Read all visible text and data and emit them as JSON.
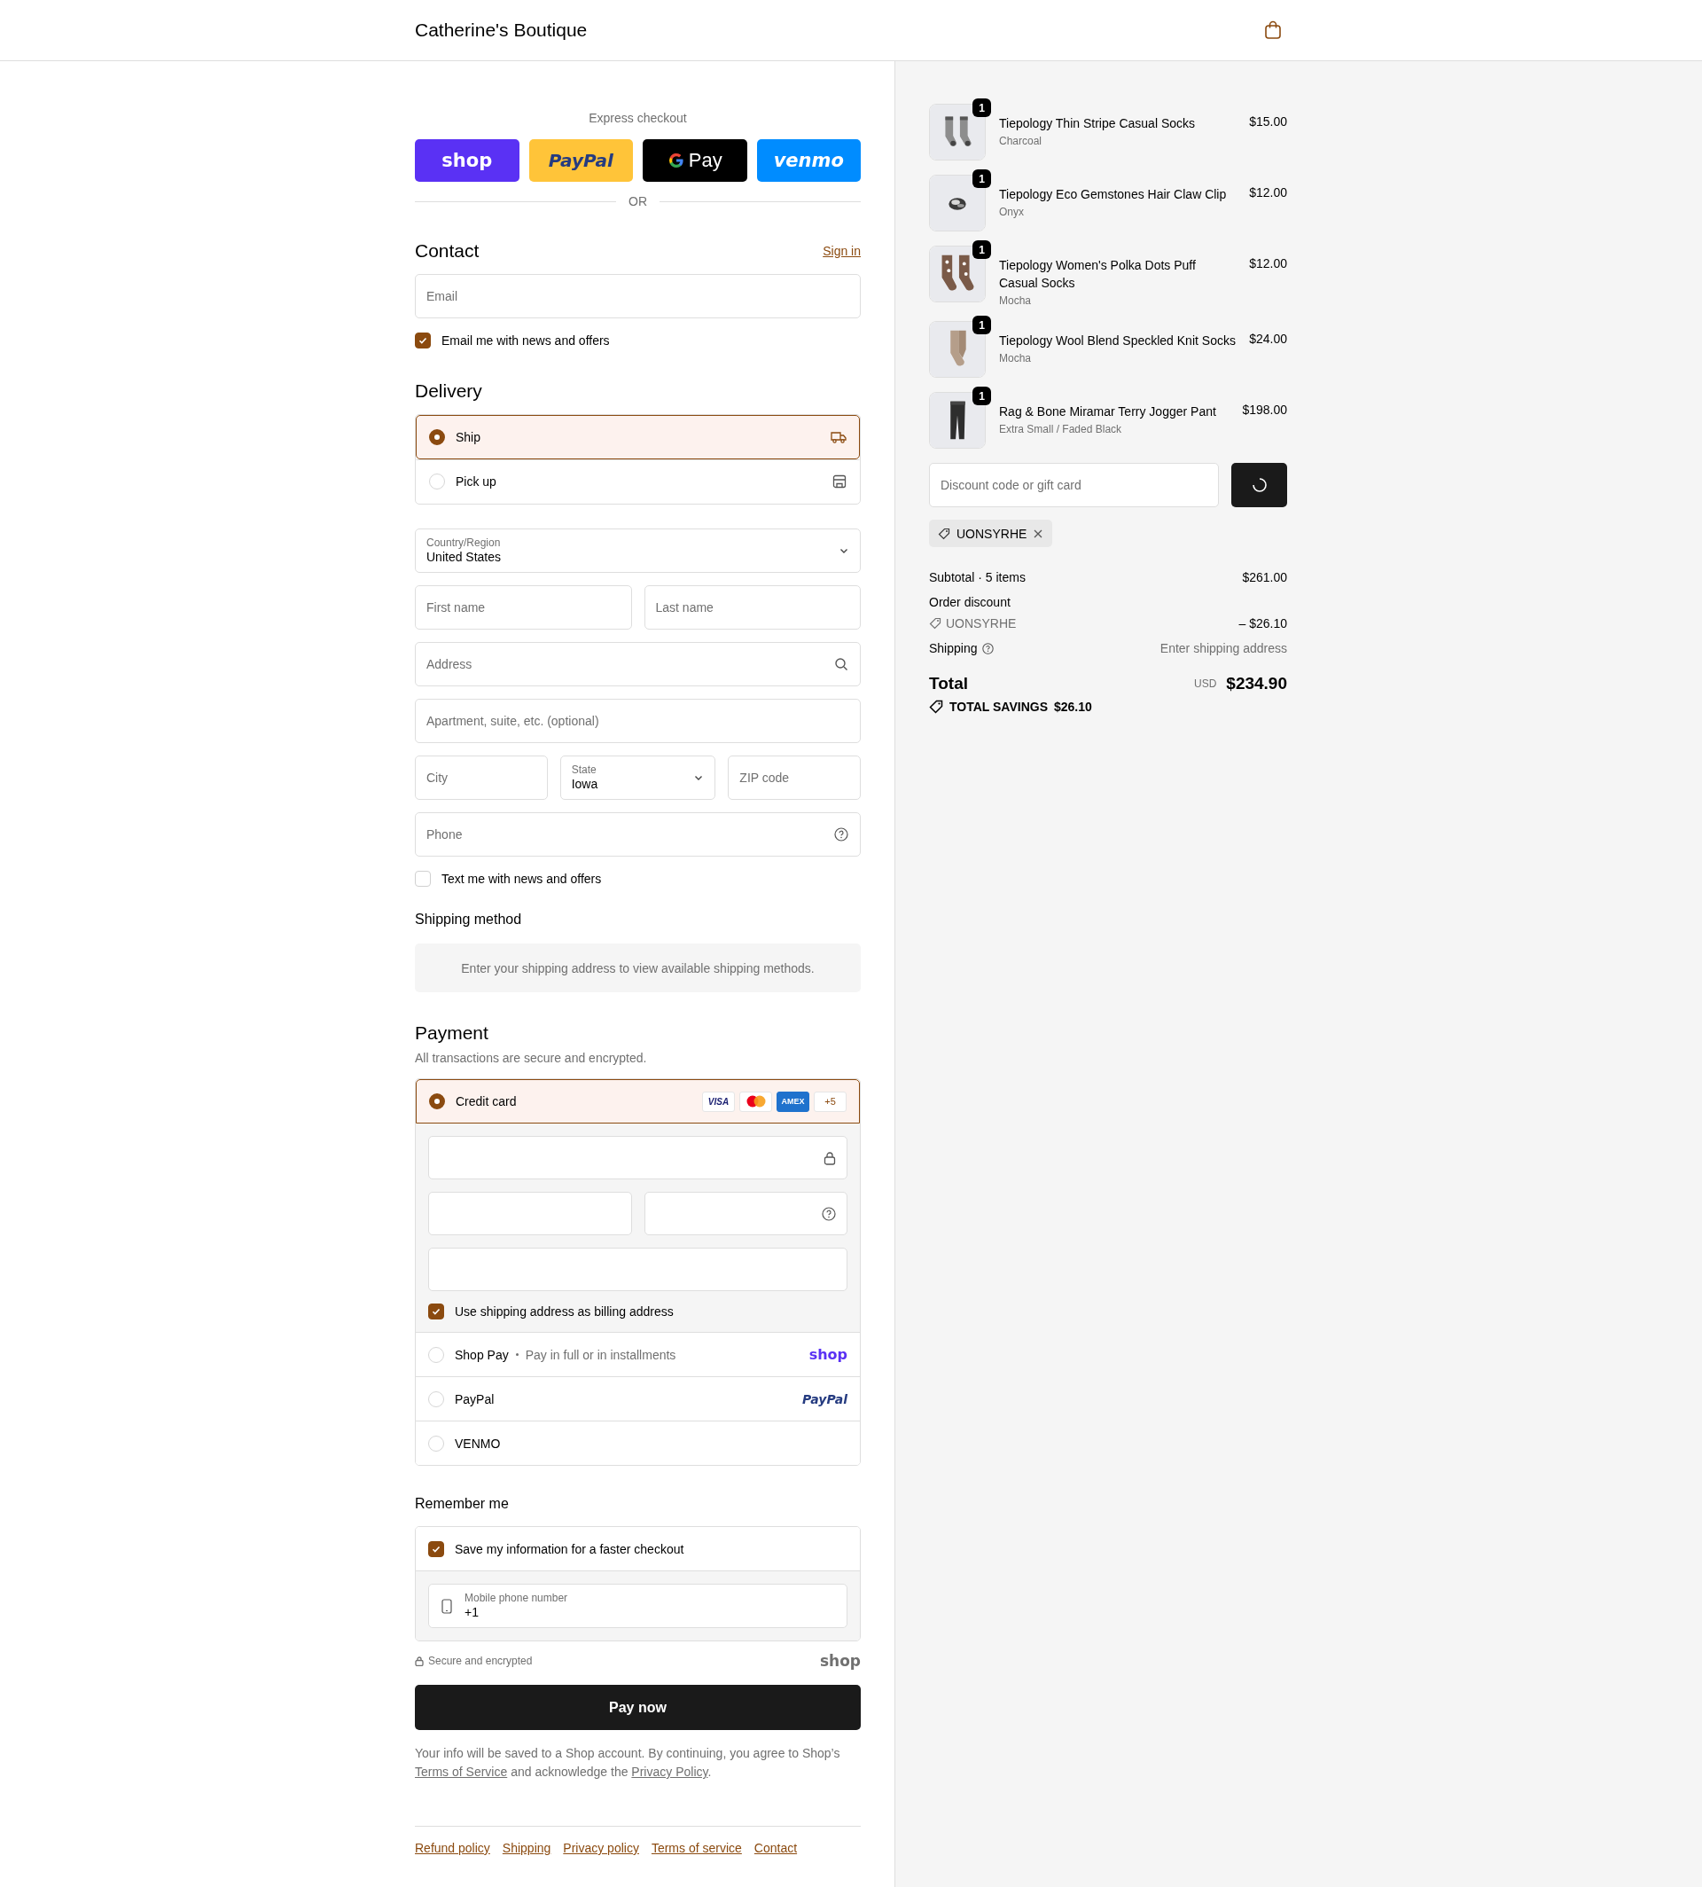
{
  "header": {
    "store_name": "Catherine's Boutique"
  },
  "express_checkout": {
    "title": "Express checkout",
    "divider": "OR",
    "buttons": [
      {
        "kind": "shop",
        "label": "shop"
      },
      {
        "kind": "paypal",
        "label": "PayPal"
      },
      {
        "kind": "gpay",
        "label": "Pay"
      },
      {
        "kind": "venmo",
        "label": "venmo"
      }
    ]
  },
  "contact": {
    "title": "Contact",
    "sign_in": "Sign in",
    "email": {
      "placeholder": "Email"
    },
    "newsletter": {
      "label": "Email me with news and offers",
      "checked": true
    }
  },
  "delivery": {
    "title": "Delivery",
    "options": [
      {
        "kind": "ship",
        "label": "Ship",
        "selected": true
      },
      {
        "kind": "pickup",
        "label": "Pick up",
        "selected": false
      }
    ],
    "address_rows": [
      [
        {
          "kind": "select",
          "label": "Country/Region",
          "value": "United States"
        }
      ],
      [
        {
          "kind": "text",
          "placeholder": "First name"
        },
        {
          "kind": "text",
          "placeholder": "Last name"
        }
      ],
      [
        {
          "kind": "search",
          "placeholder": "Address"
        }
      ],
      [
        {
          "kind": "text",
          "placeholder": "Apartment, suite, etc. (optional)"
        }
      ],
      [
        {
          "kind": "text",
          "placeholder": "City"
        },
        {
          "kind": "select",
          "label": "State",
          "value": "Iowa"
        },
        {
          "kind": "text",
          "placeholder": "ZIP code"
        }
      ],
      [
        {
          "kind": "phone",
          "placeholder": "Phone"
        }
      ]
    ],
    "sms": {
      "label": "Text me with news and offers",
      "checked": false
    }
  },
  "shipping_method": {
    "title": "Shipping method",
    "notice": "Enter your shipping address to view available shipping methods."
  },
  "payment": {
    "title": "Payment",
    "subtitle": "All transactions are secure and encrypted.",
    "methods": [
      {
        "kind": "card",
        "label": "Credit card",
        "selected": true,
        "brands": [
          {
            "kind": "visa",
            "label": "VISA"
          },
          {
            "kind": "mastercard"
          },
          {
            "kind": "amex",
            "label": "AMEX"
          },
          {
            "kind": "more",
            "label": "+5"
          }
        ],
        "billing": {
          "label": "Use shipping address as billing address",
          "checked": true
        }
      },
      {
        "kind": "shoppay",
        "label": "Shop Pay",
        "note": "Pay in full or in installments",
        "logo": "shop",
        "selected": false
      },
      {
        "kind": "paypal",
        "label": "PayPal",
        "logo": "PayPal",
        "selected": false
      },
      {
        "kind": "venmo",
        "label": "VENMO",
        "selected": false
      }
    ]
  },
  "remember_me": {
    "title": "Remember me",
    "save": {
      "label": "Save my information for a faster checkout",
      "checked": true
    },
    "phone": {
      "label": "Mobile phone number",
      "value": "+1"
    }
  },
  "secure_note": "Secure and encrypted",
  "shop_logo": "shop",
  "pay_button": "Pay now",
  "legal": [
    {
      "kind": "text",
      "text": "Your info will be saved to a Shop account. By continuing, you agree to Shop’s "
    },
    {
      "kind": "link",
      "text": "Terms of Service"
    },
    {
      "kind": "text",
      "text": " and acknowledge the "
    },
    {
      "kind": "link",
      "text": "Privacy Policy"
    },
    {
      "kind": "text",
      "text": "."
    }
  ],
  "footer_links": [
    "Refund policy",
    "Shipping",
    "Privacy policy",
    "Terms of service",
    "Contact"
  ],
  "order_summary": {
    "items": [
      {
        "name": "Tiepology Thin Stripe Casual Socks",
        "variant": "Charcoal",
        "price": "$15.00",
        "quantity": "1"
      },
      {
        "name": "Tiepology Eco Gemstones Hair Claw Clip",
        "variant": "Onyx",
        "price": "$12.00",
        "quantity": "1"
      },
      {
        "name": "Tiepology Women's Polka Dots Puff Casual Socks",
        "variant": "Mocha",
        "price": "$12.00",
        "quantity": "1"
      },
      {
        "name": "Tiepology Wool Blend Speckled Knit Socks",
        "variant": "Mocha",
        "price": "$24.00",
        "quantity": "1"
      },
      {
        "name": "Rag & Bone Miramar Terry Jogger Pant",
        "variant": "Extra Small / Faded Black",
        "price": "$198.00",
        "quantity": "1"
      }
    ],
    "discount": {
      "placeholder": "Discount code or gift card"
    },
    "applied_codes": [
      "UONSYRHE"
    ],
    "totals": {
      "subtotal_label": "Subtotal · 5 items",
      "subtotal": "$261.00",
      "discount_label": "Order discount",
      "discount_code": "UONSYRHE",
      "discount_amount": "– $26.10",
      "shipping_label": "Shipping",
      "shipping_value": "Enter shipping address",
      "total_label": "Total",
      "currency": "USD",
      "total": "$234.90",
      "savings_label": "TOTAL SAVINGS",
      "savings": "$26.10"
    }
  }
}
